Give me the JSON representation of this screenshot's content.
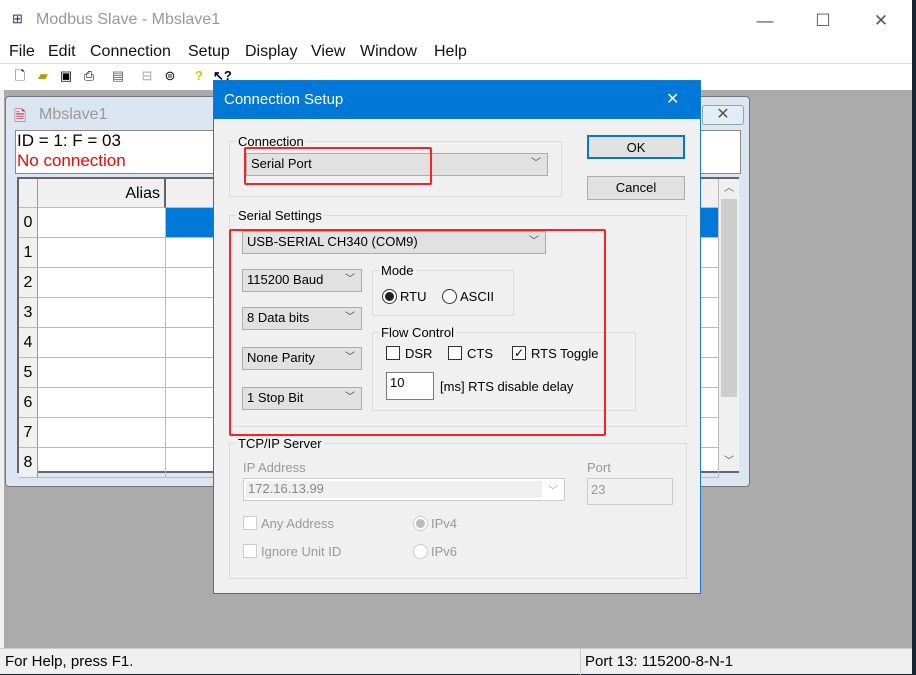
{
  "app": {
    "title": "Modbus Slave - Mbslave1",
    "minimize": "—",
    "maximize": "☐",
    "close": "✕"
  },
  "menu": [
    "File",
    "Edit",
    "Connection",
    "Setup",
    "Display",
    "View",
    "Window",
    "Help"
  ],
  "toolbar": {
    "icons": [
      "new-icon",
      "open-icon",
      "save-icon",
      "print-icon",
      "window-icon",
      "connect-icon",
      "disconnect-icon",
      "help-icon",
      "context-help-icon"
    ]
  },
  "child": {
    "title": "Mbslave1",
    "info_line1": "ID = 1: F = 03",
    "info_line2": "No connection",
    "error_color": "#ff0000",
    "alias_header": "Alias",
    "rows": [
      "0",
      "1",
      "2",
      "3",
      "4",
      "5",
      "6",
      "7",
      "8"
    ],
    "selected_color": "#0078d7"
  },
  "status": {
    "left": "For Help, press F1.",
    "right": "Port 13: 115200-8-N-1"
  },
  "dialog": {
    "title": "Connection Setup",
    "close": "✕",
    "ok": "OK",
    "cancel": "Cancel",
    "connection": {
      "label": "Connection",
      "value": "Serial Port"
    },
    "serial": {
      "label": "Serial Settings",
      "port": "USB-SERIAL CH340 (COM9)",
      "baud": "115200 Baud",
      "data_bits": "8 Data bits",
      "parity": "None Parity",
      "stop_bits": "1 Stop Bit",
      "mode": {
        "label": "Mode",
        "rtu": "RTU",
        "ascii": "ASCII",
        "selected": "RTU"
      },
      "flow": {
        "label": "Flow Control",
        "dsr": "DSR",
        "dsr_checked": false,
        "cts": "CTS",
        "cts_checked": false,
        "rts": "RTS Toggle",
        "rts_checked": true,
        "delay": "10",
        "delay_label": "[ms] RTS disable delay"
      }
    },
    "tcp": {
      "label": "TCP/IP Server",
      "ip_label": "IP Address",
      "ip": "172.16.13.99",
      "port_label": "Port",
      "port": "23",
      "any_address": "Any Address",
      "ignore_unit": "Ignore Unit ID",
      "ipv4": "IPv4",
      "ipv6": "IPv6"
    },
    "highlight_color": "#ff2020"
  }
}
